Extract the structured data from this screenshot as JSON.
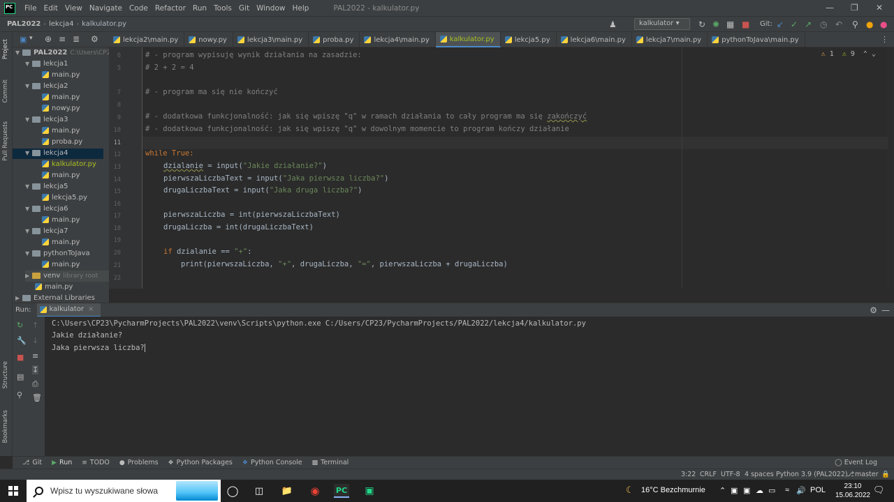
{
  "menubar": {
    "logo": "PC",
    "items": [
      "File",
      "Edit",
      "View",
      "Navigate",
      "Code",
      "Refactor",
      "Run",
      "Tools",
      "Git",
      "Window",
      "Help"
    ],
    "window_title": "PAL2022 - kalkulator.py"
  },
  "navbar": {
    "crumbs": [
      "PAL2022",
      "lekcja4",
      "kalkulator.py"
    ],
    "run_config": "kalkulator",
    "git_label": "Git:"
  },
  "left_strip": {
    "tabs": [
      "Project",
      "Commit",
      "Pull Requests",
      "Structure",
      "Bookmarks"
    ]
  },
  "tabs": [
    {
      "label": "lekcja2\\main.py",
      "active": false
    },
    {
      "label": "nowy.py",
      "active": false
    },
    {
      "label": "lekcja3\\main.py",
      "active": false
    },
    {
      "label": "proba.py",
      "active": false
    },
    {
      "label": "lekcja4\\main.py",
      "active": false
    },
    {
      "label": "kalkulator.py",
      "active": true
    },
    {
      "label": "lekcja5.py",
      "active": false
    },
    {
      "label": "lekcja6\\main.py",
      "active": false
    },
    {
      "label": "lekcja7\\main.py",
      "active": false
    },
    {
      "label": "pythonToJava\\main.py",
      "active": false
    }
  ],
  "tree": {
    "root": "PAL2022",
    "root_hint": "C:\\Users\\CP23",
    "nodes": [
      {
        "label": "lekcja1",
        "type": "folder"
      },
      {
        "label": "main.py",
        "type": "file"
      },
      {
        "label": "lekcja2",
        "type": "folder"
      },
      {
        "label": "main.py",
        "type": "file"
      },
      {
        "label": "nowy.py",
        "type": "file"
      },
      {
        "label": "lekcja3",
        "type": "folder"
      },
      {
        "label": "main.py",
        "type": "file"
      },
      {
        "label": "proba.py",
        "type": "file"
      },
      {
        "label": "lekcja4",
        "type": "folder"
      },
      {
        "label": "kalkulator.py",
        "type": "file"
      },
      {
        "label": "main.py",
        "type": "file"
      },
      {
        "label": "lekcja5",
        "type": "folder"
      },
      {
        "label": "lekcja5.py",
        "type": "file"
      },
      {
        "label": "lekcja6",
        "type": "folder"
      },
      {
        "label": "main.py",
        "type": "file"
      },
      {
        "label": "lekcja7",
        "type": "folder"
      },
      {
        "label": "main.py",
        "type": "file"
      },
      {
        "label": "pythonToJava",
        "type": "folder"
      },
      {
        "label": "main.py",
        "type": "file"
      },
      {
        "label": "venv",
        "type": "folder"
      },
      {
        "label": "main.py",
        "type": "file"
      },
      {
        "label": "External Libraries",
        "type": "lib"
      }
    ],
    "venv_hint": "library root"
  },
  "editor": {
    "line_numbers": [
      "6",
      "5",
      "",
      "7",
      "8",
      "9",
      "10",
      "11",
      "12",
      "13",
      "14",
      "15",
      "16",
      "17",
      "18",
      "19",
      "20",
      "21",
      "22"
    ],
    "current_line": "11",
    "inspections": {
      "warnings": "1",
      "weak": "9"
    }
  },
  "code": {
    "l1": "# - program wypisuję wynik działania na zasadzie:",
    "l2": "# 2 + 2 = 4",
    "l3": "# - program ma się nie kończyć",
    "l4a": "# - dodatkowa funkcjonalność: jak się wpiszę \"q\" w ramach działania to cały program ma się ",
    "l4b": "zakończyć",
    "l5": "# - dodatkowa funkcjonalność: jak się wpiszę \"q\" w dowolnym momencie to program kończy działanie",
    "l6_kw": "while",
    "l6_rest": " True:",
    "l7_var": "dzialanie",
    "l7_eq": " = input(",
    "l7_str": "\"Jakie działanie?\"",
    "l8_pre": "pierwszaLiczbaText = input(",
    "l8_str": "\"Jaka pierwsza liczba?\"",
    "l9_pre": "drugaLiczbaText = input(",
    "l9_str": "\"Jaka druga liczba?\"",
    "l10": "pierwszaLiczba = int(pierwszaLiczbaText)",
    "l11": "drugaLiczba = int(drugaLiczbaText)",
    "l12_kw": "if",
    "l12_pre": " dzialanie == ",
    "l12_str": "\"+\"",
    "l13_pre": "print(pierwszaLiczba, ",
    "l13_s1": "\"+\"",
    "l13_mid": ", drugaLiczba, ",
    "l13_s2": "\"=\"",
    "l13_end": ", pierwszaLiczba + drugaLiczba)",
    "close": ")",
    "colon": ":"
  },
  "run": {
    "label": "Run:",
    "tab": "kalkulator",
    "lines": [
      "C:\\Users\\CP23\\PycharmProjects\\PAL2022\\venv\\Scripts\\python.exe C:/Users/CP23/PycharmProjects/PAL2022/lekcja4/kalkulator.py",
      "Jakie działanie?",
      "Jaka pierwsza liczba?"
    ]
  },
  "bottom_tools": [
    "Git",
    "Run",
    "TODO",
    "Problems",
    "Python Packages",
    "Python Console",
    "Terminal"
  ],
  "event_log": "Event Log",
  "status": {
    "position": "3:22",
    "line_sep": "CRLF",
    "encoding": "UTF-8",
    "indent": "4 spaces",
    "interpreter": "Python 3.9 (PAL2022)",
    "branch": "master"
  },
  "taskbar": {
    "search_placeholder": "Wpisz tu wyszukiwane słowa",
    "weather": "16°C  Bezchmurnie",
    "lang": "POL",
    "time": "23:10",
    "date": "15.06.2022"
  },
  "colors": {
    "accent": "#4a88c7",
    "comment": "#808080",
    "keyword": "#cc7832",
    "string": "#6a8759",
    "active_file": "#a8c023"
  }
}
